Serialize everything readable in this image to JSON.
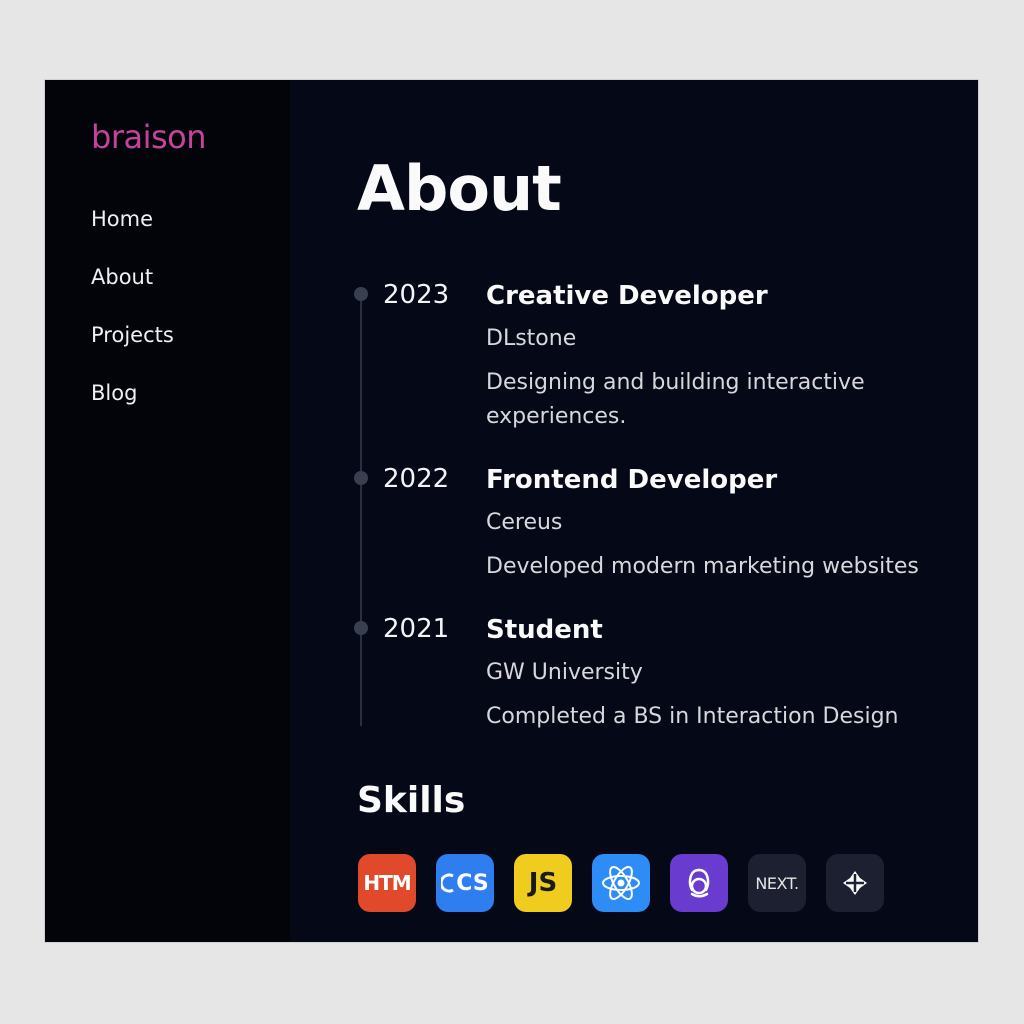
{
  "brand": {
    "name": "braison"
  },
  "nav": {
    "items": [
      {
        "label": "Home"
      },
      {
        "label": "About"
      },
      {
        "label": "Projects"
      },
      {
        "label": "Blog"
      }
    ]
  },
  "main": {
    "title": "About"
  },
  "timeline": [
    {
      "year": "2023",
      "title": "Creative Developer",
      "org": "DLstone",
      "desc": "Designing and building interactive experiences."
    },
    {
      "year": "2022",
      "title": "Frontend Developer",
      "org": "Cereus",
      "desc": "Developed modern marketing websites"
    },
    {
      "year": "2021",
      "title": "Student",
      "org": "GW University",
      "desc": "Completed a BS in Interaction Design"
    }
  ],
  "skills": {
    "title": "Skills",
    "items": [
      {
        "label": "HTM",
        "icon": "html-icon",
        "color": "#e0492a",
        "text_color": "#ffffff"
      },
      {
        "label": "CS",
        "icon": "css-icon",
        "color": "#2f7ef0",
        "text_color": "#ffffff"
      },
      {
        "label": "JS",
        "icon": "javascript-icon",
        "color": "#f0cc1e",
        "text_color": "#1a1a1a"
      },
      {
        "label": "",
        "icon": "react-icon",
        "color": "#2d8cf5",
        "text_color": "#ffffff"
      },
      {
        "label": "",
        "icon": "redux-icon",
        "color": "#6a3bcf",
        "text_color": "#ffffff"
      },
      {
        "label": "NEXT.",
        "icon": "nextjs-icon",
        "color": "#1c2030",
        "text_color": "#e6e6e6"
      },
      {
        "label": "",
        "icon": "figma-icon",
        "color": "#1c2030",
        "text_color": "#ffffff"
      }
    ]
  }
}
